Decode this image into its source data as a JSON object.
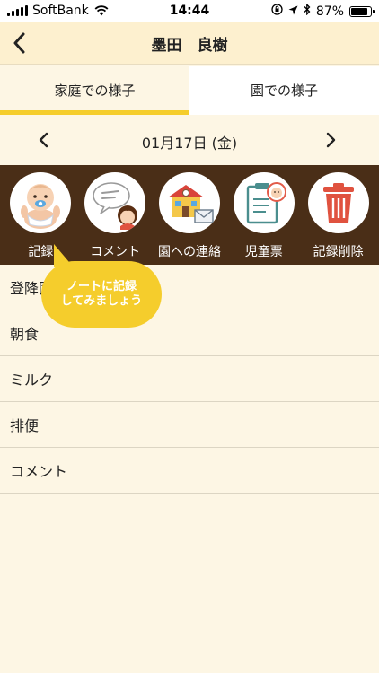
{
  "status_bar": {
    "carrier": "SoftBank",
    "time": "14:44",
    "battery_text": "87%",
    "battery_level": 0.87
  },
  "nav": {
    "title": "墨田　良樹",
    "back_icon": "chevron-left-icon"
  },
  "tabs": [
    {
      "label": "家庭での様子",
      "active": true
    },
    {
      "label": "園での様子",
      "active": false
    }
  ],
  "date_nav": {
    "prev": "<",
    "date": "01月17日 (金)",
    "next": ">"
  },
  "toolbar": {
    "items": [
      {
        "label": "記録",
        "icon": "baby-icon"
      },
      {
        "label": "コメント",
        "icon": "comment-icon"
      },
      {
        "label": "園への連絡",
        "icon": "school-mail-icon"
      },
      {
        "label": "児童票",
        "icon": "clipboard-icon"
      },
      {
        "label": "記録削除",
        "icon": "trash-icon"
      }
    ]
  },
  "list": {
    "items": [
      {
        "label": "登降園時"
      },
      {
        "label": "朝食"
      },
      {
        "label": "ミルク"
      },
      {
        "label": "排便"
      },
      {
        "label": "コメント"
      }
    ]
  },
  "tooltip": {
    "line1": "ノートに記録",
    "line2": "してみましょう"
  },
  "colors": {
    "accent": "#f5cd2c",
    "toolbar_bg": "#4a2e17",
    "page_bg": "#fdf6e4",
    "nav_bg": "#fdf0cf"
  }
}
